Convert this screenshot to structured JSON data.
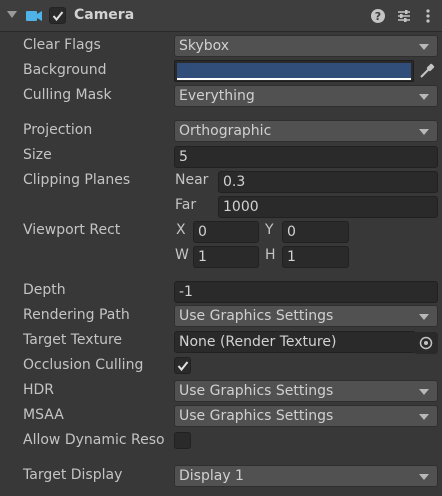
{
  "header": {
    "title": "Camera",
    "enabled": true,
    "icons": [
      "fold-arrow-icon",
      "camera-icon",
      "help-icon",
      "presets-icon",
      "more-options-icon"
    ]
  },
  "fields": {
    "clear_flags": {
      "label": "Clear Flags",
      "value": "Skybox"
    },
    "background": {
      "label": "Background",
      "color": "#314d79"
    },
    "culling_mask": {
      "label": "Culling Mask",
      "value": "Everything"
    },
    "projection": {
      "label": "Projection",
      "value": "Orthographic"
    },
    "size": {
      "label": "Size",
      "value": "5"
    },
    "clipping_planes": {
      "label": "Clipping Planes",
      "near_label": "Near",
      "near": "0.3",
      "far_label": "Far",
      "far": "1000"
    },
    "viewport_rect": {
      "label": "Viewport Rect",
      "x_label": "X",
      "x": "0",
      "y_label": "Y",
      "y": "0",
      "w_label": "W",
      "w": "1",
      "h_label": "H",
      "h": "1"
    },
    "depth": {
      "label": "Depth",
      "value": "-1"
    },
    "rendering_path": {
      "label": "Rendering Path",
      "value": "Use Graphics Settings"
    },
    "target_texture": {
      "label": "Target Texture",
      "value": "None (Render Texture)"
    },
    "occlusion_culling": {
      "label": "Occlusion Culling",
      "checked": true
    },
    "hdr": {
      "label": "HDR",
      "value": "Use Graphics Settings"
    },
    "msaa": {
      "label": "MSAA",
      "value": "Use Graphics Settings"
    },
    "allow_dynamic_resolution": {
      "label": "Allow Dynamic Reso",
      "checked": false
    },
    "target_display": {
      "label": "Target Display",
      "value": "Display 1"
    }
  },
  "colors": {
    "panel_bg": "#383838",
    "header_bg": "#3e3e3e",
    "dropdown_bg": "#515151",
    "field_bg": "#2a2a2a",
    "camera_icon": "#4fb3e8"
  }
}
